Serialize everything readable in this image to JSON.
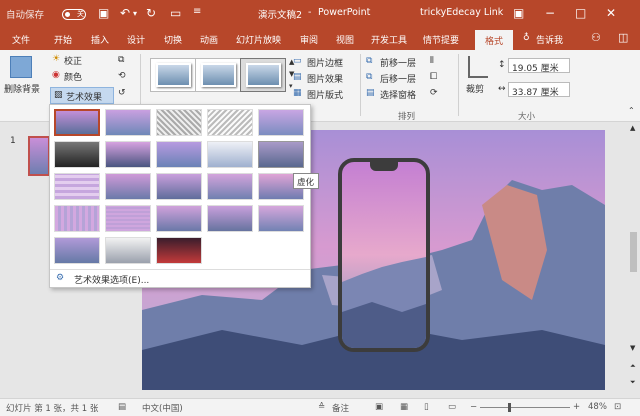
{
  "window": {
    "autosave_label": "自动保存",
    "autosave_state": "关",
    "doc_title": "演示文稿2",
    "separator": "-",
    "app_name": "PowerPoint",
    "user": "trickyEdecay Link"
  },
  "tabs": [
    "文件",
    "开始",
    "插入",
    "设计",
    "切换",
    "动画",
    "幻灯片放映",
    "审阅",
    "视图",
    "开发工具",
    "情节提要",
    "格式"
  ],
  "tell_me": "告诉我",
  "ribbon": {
    "remove_bg": "删除背景",
    "correct": "校正",
    "color": "颜色",
    "artistic_effects": "艺术效果",
    "picture_border": "图片边框",
    "picture_effects": "图片效果",
    "picture_layout": "图片版式",
    "bring_forward": "前移一层",
    "send_backward": "后移一层",
    "selection_pane": "选择窗格",
    "arrange_group": "排列",
    "crop": "裁剪",
    "height_value": "19.05 厘米",
    "width_value": "33.87 厘米",
    "size_group": "大小"
  },
  "dropdown": {
    "options_label": "艺术效果选项(E)...",
    "tooltip": "虚化"
  },
  "slide_number": "1",
  "status": {
    "slide_info": "幻灯片 第 1 张，共 1 张",
    "language": "中文(中国)",
    "notes": "备注",
    "zoom": "48%"
  },
  "colors": {
    "accent": "#b7472a",
    "ribbon_bg": "#f3f3f3",
    "tooltip_bg": "#ffffff"
  }
}
